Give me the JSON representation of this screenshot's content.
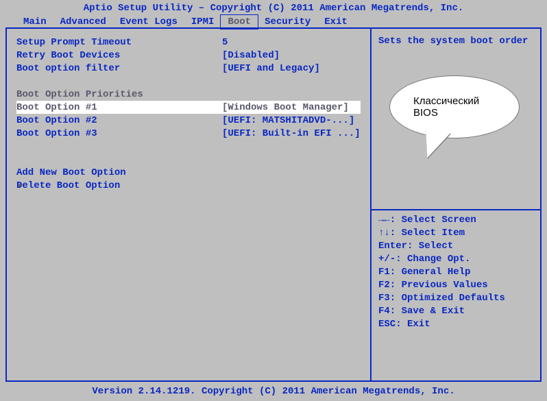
{
  "title": "Aptio Setup Utility – Copyright (C) 2011 American Megatrends, Inc.",
  "footer": "Version 2.14.1219. Copyright (C) 2011 American Megatrends, Inc.",
  "menubar": {
    "items": [
      "Main",
      "Advanced",
      "Event Logs",
      "IPMI",
      "Boot",
      "Security",
      "Exit"
    ],
    "active_index": 4
  },
  "left": {
    "rows": [
      {
        "label": "Setup Prompt Timeout",
        "value": "5",
        "type": "item"
      },
      {
        "label": "Retry Boot Devices",
        "value": "[Disabled]",
        "type": "item"
      },
      {
        "label": "Boot option filter",
        "value": "[UEFI and Legacy]",
        "type": "item"
      }
    ],
    "priorities_header": "Boot Option Priorities",
    "priorities": [
      {
        "label": "Boot Option #1",
        "value": "[Windows Boot Manager]",
        "selected": true
      },
      {
        "label": "Boot Option #2",
        "value": "[UEFI: MATSHITADVD-...]",
        "selected": false
      },
      {
        "label": "Boot Option #3",
        "value": "[UEFI: Built-in EFI ...]",
        "selected": false
      }
    ],
    "actions": [
      "Add New Boot Option",
      "Delete Boot Option"
    ],
    "cursor_on_action_index": 1
  },
  "right": {
    "help_text": "Sets the system boot order",
    "keys": [
      "→←: Select Screen",
      "↑↓: Select Item",
      "Enter: Select",
      "+/-: Change Opt.",
      "F1: General Help",
      "F2: Previous Values",
      "F3: Optimized Defaults",
      "F4: Save & Exit",
      "ESC: Exit"
    ]
  },
  "bubble": {
    "line1": "Классический",
    "line2": "BIOS"
  }
}
